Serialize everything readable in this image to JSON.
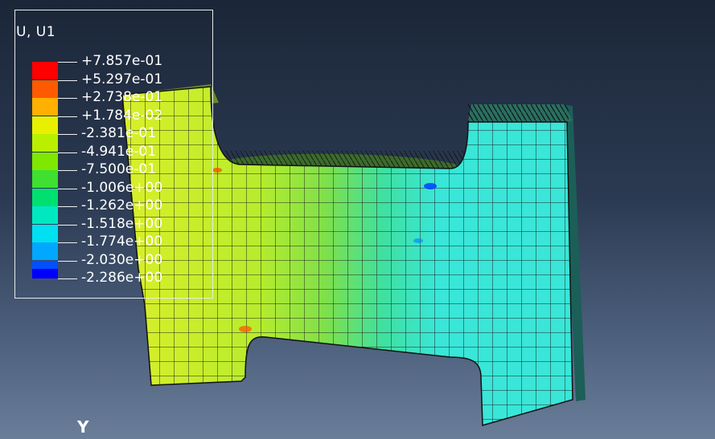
{
  "legend": {
    "title": "U, U1",
    "levels": [
      {
        "label": "+7.857e-01",
        "color": "#ff0000"
      },
      {
        "label": "+5.297e-01",
        "color": "#ff5a00"
      },
      {
        "label": "+2.738e-01",
        "color": "#ffb000"
      },
      {
        "label": "+1.784e-02",
        "color": "#e8f000"
      },
      {
        "label": "-2.381e-01",
        "color": "#b8f000"
      },
      {
        "label": "-4.941e-01",
        "color": "#7fe800"
      },
      {
        "label": "-7.500e-01",
        "color": "#3fe030"
      },
      {
        "label": "-1.006e+00",
        "color": "#00e070"
      },
      {
        "label": "-1.262e+00",
        "color": "#00e8c0"
      },
      {
        "label": "-1.518e+00",
        "color": "#00e0f0"
      },
      {
        "label": "-1.774e+00",
        "color": "#00a8ff"
      },
      {
        "label": "-2.030e+00",
        "color": "#0050ff"
      },
      {
        "label": "-2.286e+00",
        "color": "#0000ff"
      }
    ]
  },
  "triad": {
    "axis_y_label": "Y"
  },
  "model": {
    "colors": {
      "yellow": "#d9ef2a",
      "yellow_green": "#b2ea2a",
      "green": "#7fe04a",
      "aqua": "#3fe0b8",
      "cyan": "#39e6d8",
      "outline": "#1a1a1a"
    }
  }
}
